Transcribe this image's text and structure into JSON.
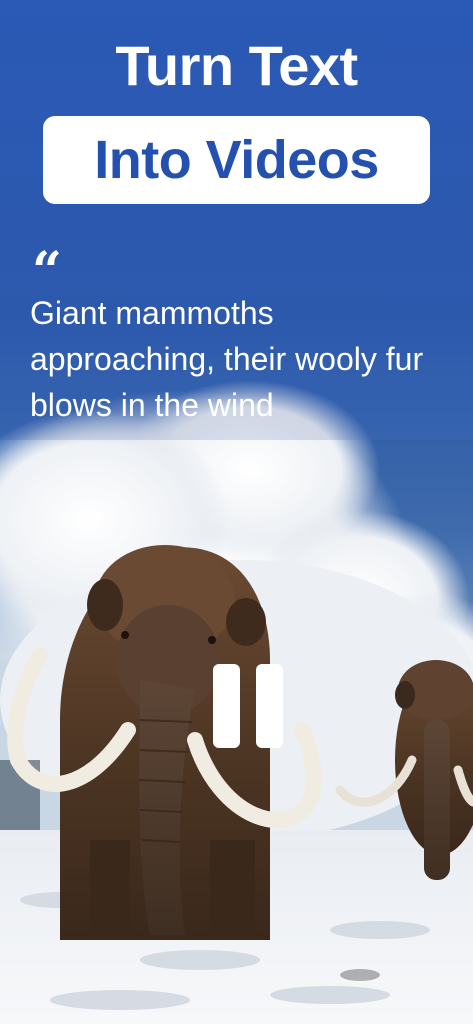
{
  "header": {
    "title_line1": "Turn Text",
    "title_line2": "Into Videos"
  },
  "prompt": {
    "quote_glyph": "“",
    "text": "Giant mammoths approaching, their wooly fur blows in the wind"
  },
  "video": {
    "subject": "woolly mammoths walking through snow",
    "state": "playing"
  },
  "colors": {
    "background_blue": "#2c5fbf",
    "pill_text": "#2451b0",
    "text": "#ffffff"
  },
  "icons": {
    "quote": "quote-icon",
    "pause": "pause-icon"
  }
}
